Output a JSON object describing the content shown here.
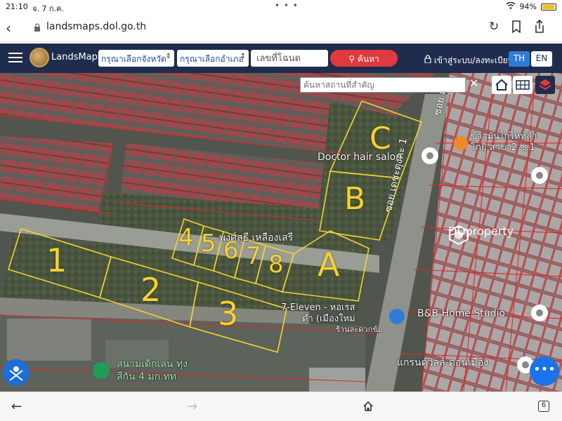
{
  "status_bar": {
    "time": "21:10",
    "date": "จ. 7 ก.ค.",
    "battery": "94%",
    "battery_level": 0.94
  },
  "browser": {
    "url": "landsmaps.dol.go.th",
    "tab_count": "6"
  },
  "header": {
    "title": "LandsMaps",
    "province_select": "กรุณาเลือกจังหวัด",
    "district_select": "กรุณาเลือกอำเภอ",
    "deed_placeholder": "เลขที่โฉนด",
    "search_label": "ค้นหา",
    "login_label": "เข้าสู่ระบบ/ลงทะเบียน",
    "lang_th": "TH",
    "lang_en": "EN"
  },
  "map": {
    "place_search_placeholder": "ค้นหาสถานที่สำคัญ",
    "plot_labels": [
      "1",
      "2",
      "3",
      "4",
      "5",
      "6",
      "7",
      "8",
      "A",
      "B",
      "C"
    ],
    "owner_label": "พงศ์สุธี เหลืองเสรี",
    "pois": {
      "doctor_hair": "Doctor hair salon",
      "chicken_rice_1": "ข้าวมันไก่ไหหลำ",
      "chicken_rice_2": "โกยิ สาขา2 ซ.1",
      "seven_eleven_1": "7-Eleven - หอเรส",
      "seven_eleven_2": "ดำ (เมืองใหม่",
      "seven_eleven_3": "ร้านละดวกข้อ",
      "bb_home": "B&B Home Studio",
      "grand_villa": "แกรนด์วิลล์-ดอนเมือง",
      "playground_1": "สนามเด็กเล่น ทุ่ง",
      "playground_2": "สีกัน 4 มก.ทท"
    },
    "road_labels": {
      "road_1": "ซอย เดชะตุงคะ 1",
      "road_2": "ซอย เ"
    },
    "watermark": "DDproperty"
  }
}
